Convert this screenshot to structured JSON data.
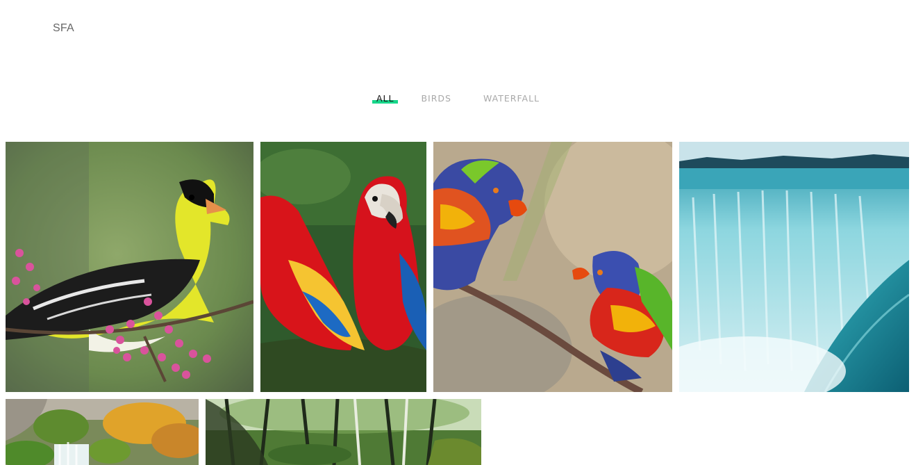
{
  "site": {
    "logo": "SFA"
  },
  "filters": [
    {
      "label": "ALL",
      "active": true
    },
    {
      "label": "BIRDS",
      "active": false
    },
    {
      "label": "WATERFALL",
      "active": false
    }
  ],
  "gallery": {
    "accent_color": "#17d68a",
    "items": [
      {
        "subject": "goldfinch-on-branch",
        "category": "BIRDS"
      },
      {
        "subject": "scarlet-macaws",
        "category": "BIRDS"
      },
      {
        "subject": "rainbow-lorikeets",
        "category": "BIRDS"
      },
      {
        "subject": "horseshoe-waterfall",
        "category": "WATERFALL"
      },
      {
        "subject": "autumn-waterfall",
        "category": "WATERFALL"
      },
      {
        "subject": "forest-stream",
        "category": "WATERFALL"
      }
    ]
  }
}
